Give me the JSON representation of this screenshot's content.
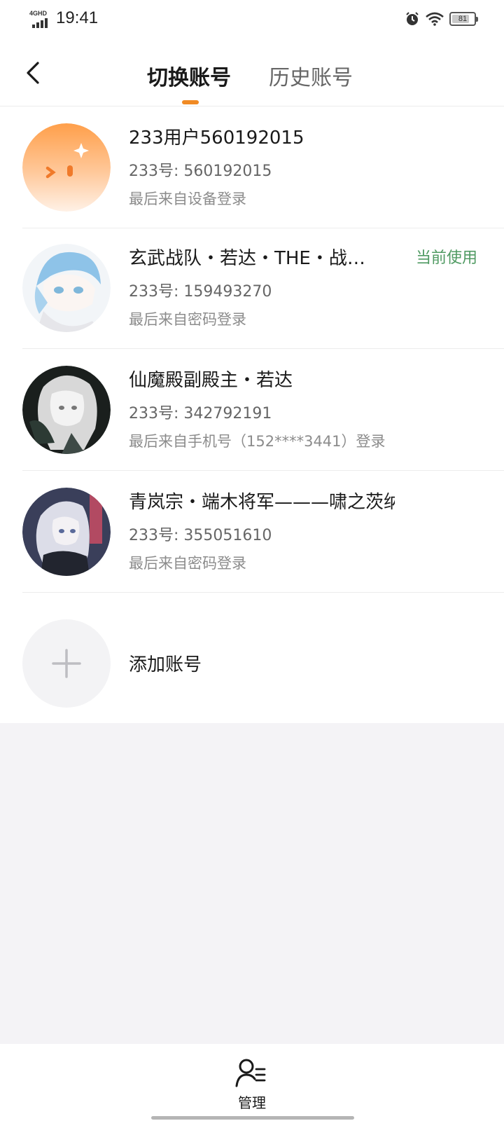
{
  "status_bar": {
    "network": "4GHD",
    "time": "19:41",
    "battery": "81",
    "battery_level": 0.81,
    "icons": [
      "alarm-icon",
      "wifi-icon",
      "battery-icon"
    ]
  },
  "header": {
    "tabs": [
      {
        "label": "切换账号",
        "active": true
      },
      {
        "label": "历史账号",
        "active": false
      }
    ],
    "accent_color": "#f08a24"
  },
  "accounts": [
    {
      "name": "233用户560192015",
      "uid": "233号: 560192015",
      "login": "最后来自设备登录",
      "current": ""
    },
    {
      "name": "玄武战队・若达・THE・战…",
      "uid": "233号: 159493270",
      "login": "最后来自密码登录",
      "current": "当前使用"
    },
    {
      "name": "仙魔殿副殿主・若达",
      "uid": "233号: 342792191",
      "login": "最后来自手机号（152****3441）登录",
      "current": ""
    },
    {
      "name": "青岚宗・端木将军———啸之茨纳米",
      "uid": "233号: 355051610",
      "login": "最后来自密码登录",
      "current": ""
    }
  ],
  "add_account": {
    "label": "添加账号"
  },
  "bottom": {
    "manage_label": "管理"
  },
  "colors": {
    "current_tag": "#4f9a62",
    "background": "#f4f3f6"
  }
}
